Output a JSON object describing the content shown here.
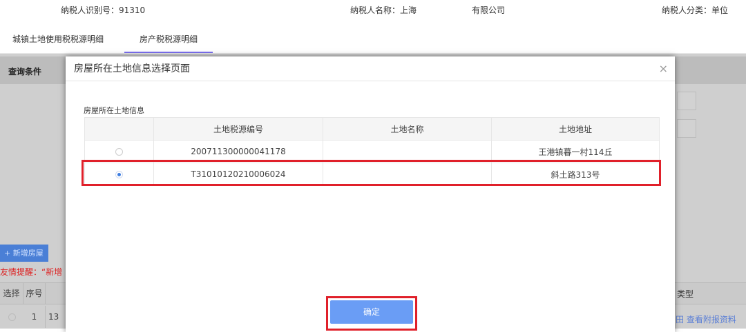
{
  "header": {
    "taxpayer_id": "纳税人识别号：91310",
    "taxpayer_name": "纳税人名称：上海",
    "company_suffix": "有限公司",
    "taxpayer_type": "纳税人分类：单位"
  },
  "tabs": [
    {
      "label": "城镇土地使用税税源明细"
    },
    {
      "label": "房产税税源明细",
      "active": true
    }
  ],
  "background": {
    "query_title": "查询条件",
    "add_button": "+ 新增房屋",
    "tip": "友情提醒：“新增",
    "table_headers": [
      "选择",
      "序号"
    ],
    "row": {
      "index": "1",
      "id_prefix": "13"
    },
    "type_header": "类型",
    "attachment_link": "田 查看附报资料"
  },
  "dialog": {
    "title": "房屋所在土地信息选择页面",
    "close": "×",
    "section_label": "房屋所在土地信息",
    "columns": [
      "",
      "土地税源编号",
      "土地名称",
      "土地地址"
    ],
    "rows": [
      {
        "selected": false,
        "code": "200711300000041178",
        "name": "",
        "address": "王港镇暮一村114丘"
      },
      {
        "selected": true,
        "code": "T31010120210006024",
        "name": "",
        "address": "斜土路313号"
      }
    ],
    "confirm": "确定"
  },
  "colors": {
    "accent": "#6a9df5",
    "highlight": "#e0202a",
    "tab_underline": "#7a6ff0"
  }
}
